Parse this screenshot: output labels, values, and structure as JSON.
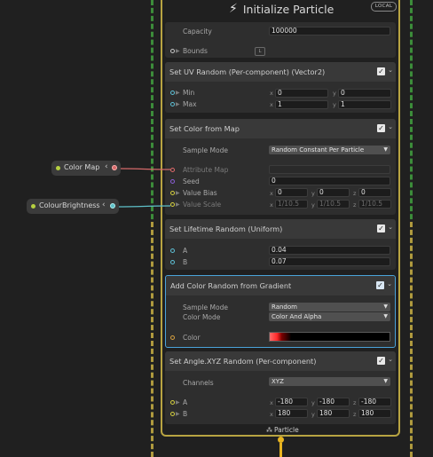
{
  "colors": {
    "background": "#202020",
    "frame": "#b8a442",
    "dashed_green": "#3c8c3a",
    "dashed_yellow": "#b09a3e",
    "selected_border": "#4aa3d9",
    "port_yellow": "#d6d040",
    "port_cyan": "#5ec0d6",
    "port_purple": "#8a5ed6",
    "port_red": "#e06a6a",
    "port_gray": "#c8c8c8",
    "wire_red": "#d66a6a",
    "wire_cyan": "#5ec0c8"
  },
  "header": {
    "icon": "bolt-icon",
    "title": "Initialize Particle",
    "badge": "LOCAL"
  },
  "context": {
    "capacity_label": "Capacity",
    "capacity_value": "100000",
    "bounds_label": "Bounds",
    "bounds_icon": "link-icon"
  },
  "blocks": {
    "uv": {
      "title": "Set UV Random (Per-component) (Vector2)",
      "min_label": "Min",
      "max_label": "Max",
      "min_x": "0",
      "min_y": "0",
      "max_x": "1",
      "max_y": "1"
    },
    "color_map": {
      "title": "Set Color from Map",
      "sample_mode_label": "Sample Mode",
      "sample_mode_value": "Random Constant Per Particle",
      "attribute_map_label": "Attribute Map",
      "seed_label": "Seed",
      "seed_value": "0",
      "value_bias_label": "Value Bias",
      "value_bias_x": "0",
      "value_bias_y": "0",
      "value_bias_z": "0",
      "value_scale_label": "Value Scale",
      "value_scale_x": "1/10.5",
      "value_scale_y": "1/10.5",
      "value_scale_z": "1/10.5"
    },
    "lifetime": {
      "title": "Set Lifetime Random (Uniform)",
      "a_label": "A",
      "a_value": "0.04",
      "b_label": "B",
      "b_value": "0.07"
    },
    "gradient": {
      "title": "Add Color Random from Gradient",
      "sample_mode_label": "Sample Mode",
      "sample_mode_value": "Random",
      "color_mode_label": "Color Mode",
      "color_mode_value": "Color And Alpha",
      "color_label": "Color"
    },
    "angle": {
      "title": "Set Angle.XYZ Random (Per-component)",
      "channels_label": "Channels",
      "channels_value": "XYZ",
      "a_label": "A",
      "b_label": "B",
      "a_x": "-180",
      "a_y": "-180",
      "a_z": "-180",
      "b_x": "180",
      "b_y": "180",
      "b_z": "180"
    }
  },
  "axes": {
    "x": "x",
    "y": "y",
    "z": "z"
  },
  "side_nodes": {
    "color_map": "Color Map",
    "colour_brightness": "ColourBrightness"
  },
  "footer": {
    "icon": "particle-icon",
    "label": "Particle"
  }
}
